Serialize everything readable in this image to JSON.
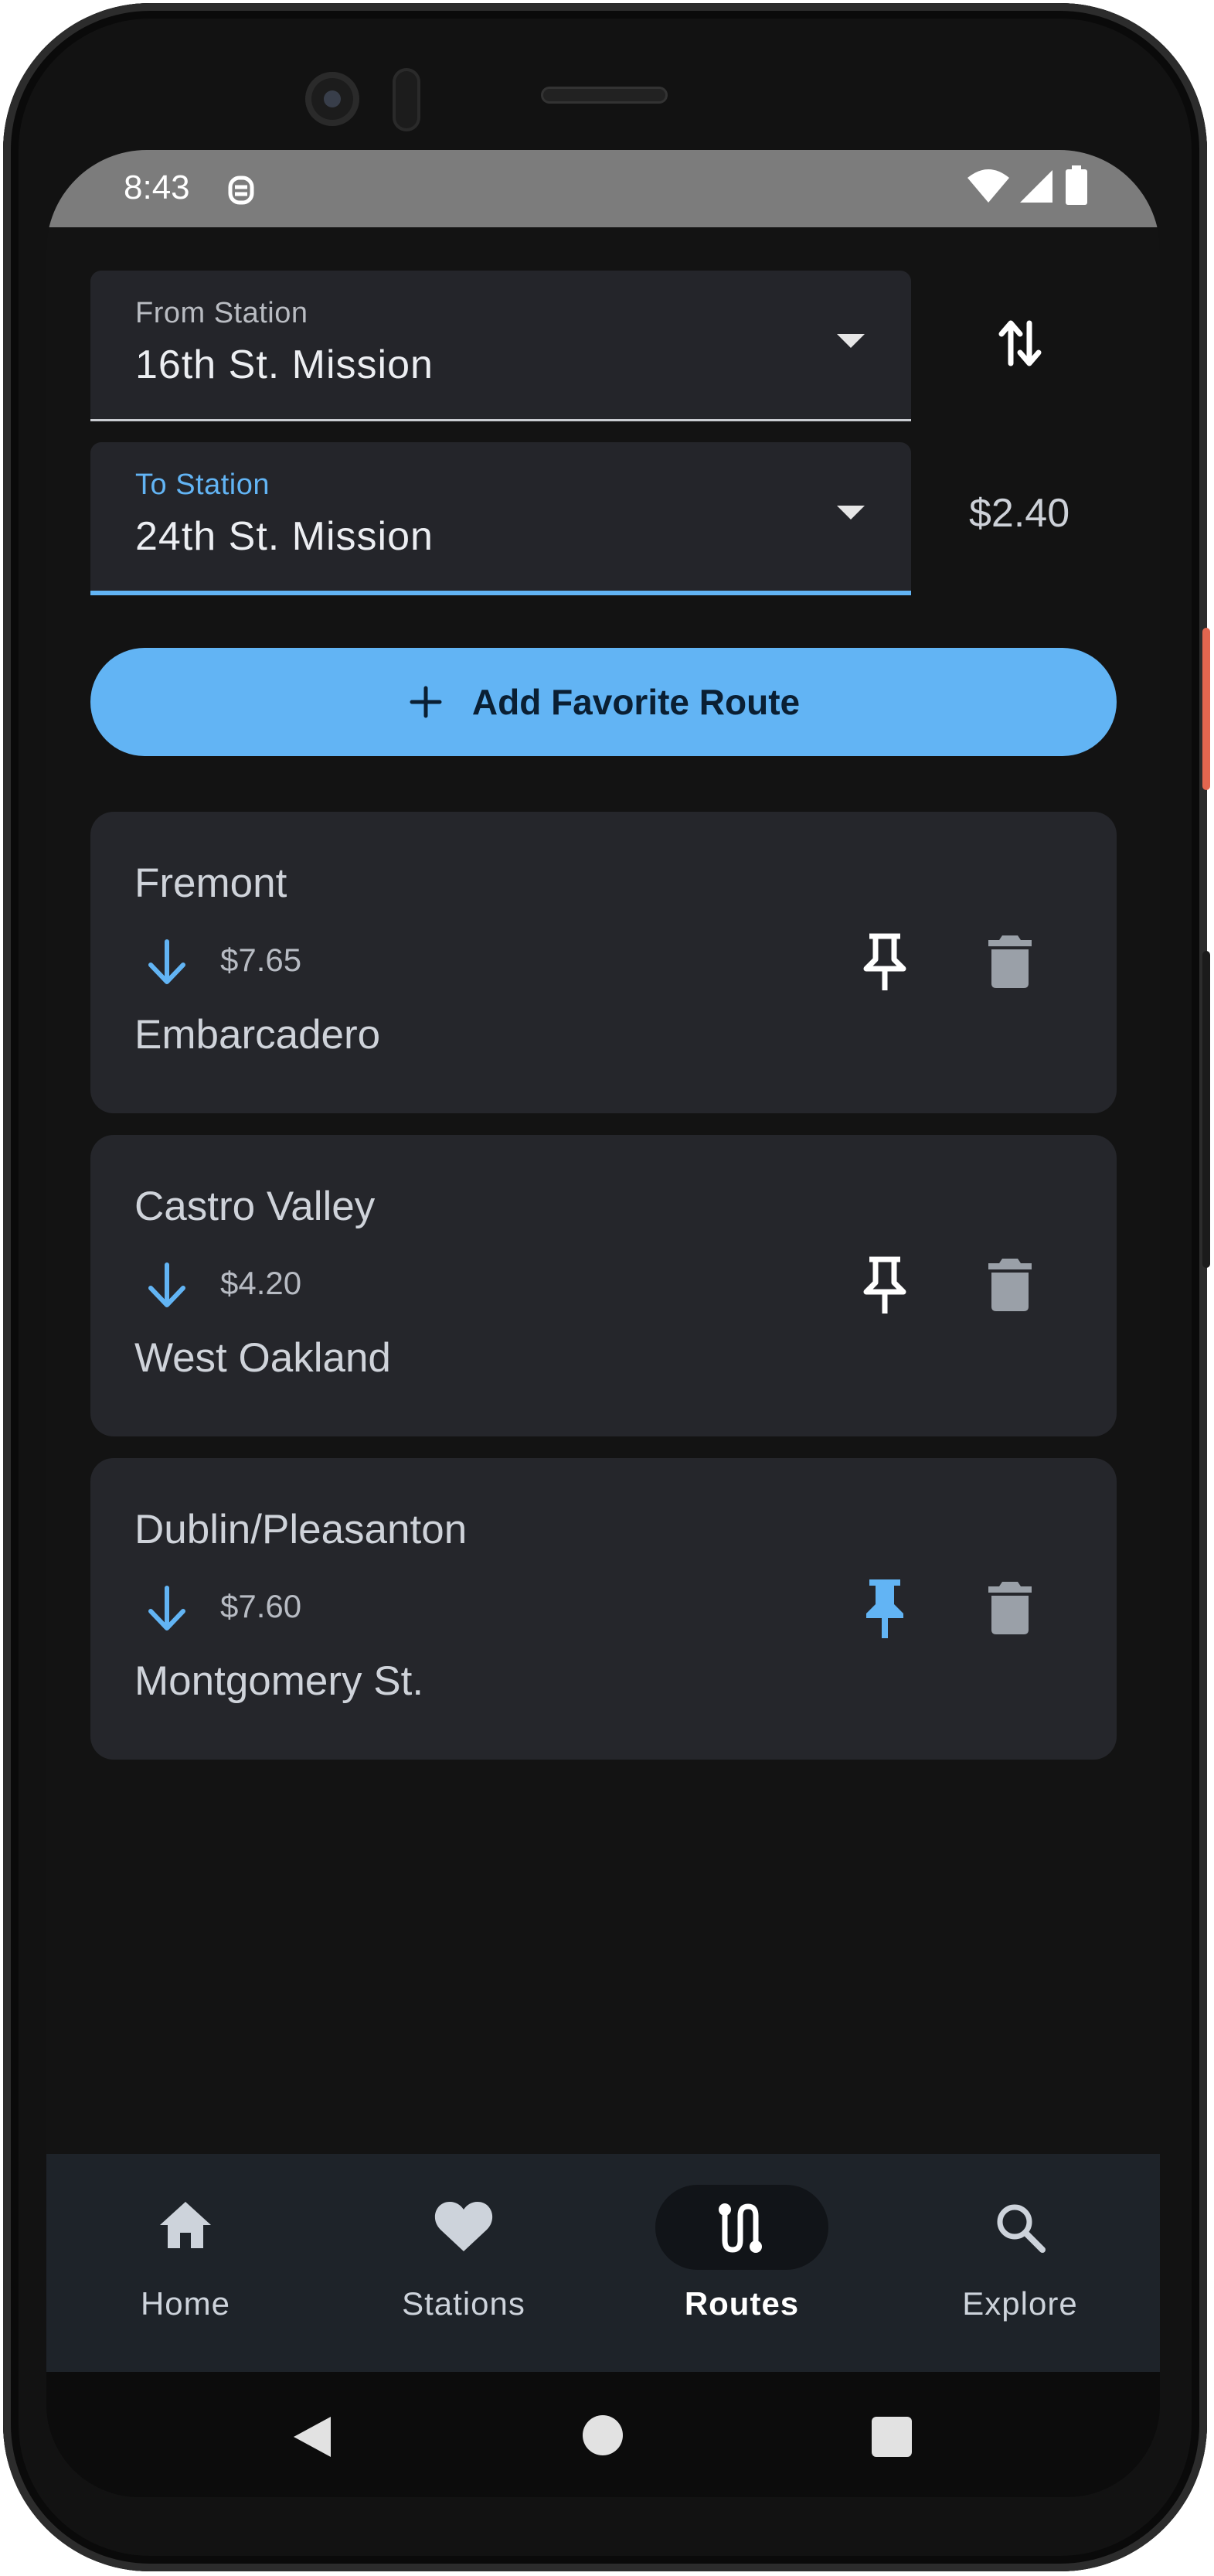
{
  "status_bar": {
    "time": "8:43"
  },
  "from_station": {
    "label": "From Station",
    "value": "16th St. Mission"
  },
  "to_station": {
    "label": "To Station",
    "value": "24th St. Mission"
  },
  "fare": "$2.40",
  "add_favorite_route": {
    "label": "Add Favorite Route",
    "icon": "plus-icon"
  },
  "routes": [
    {
      "from": "Fremont",
      "fare": "$7.65",
      "to": "Embarcadero",
      "pinned": false
    },
    {
      "from": "Castro Valley",
      "fare": "$4.20",
      "to": "West Oakland",
      "pinned": false
    },
    {
      "from": "Dublin/Pleasanton",
      "fare": "$7.60",
      "to": "Montgomery St.",
      "pinned": true
    }
  ],
  "bottom_nav": {
    "items": [
      {
        "label": "Home",
        "icon": "home-icon"
      },
      {
        "label": "Stations",
        "icon": "heart-icon"
      },
      {
        "label": "Routes",
        "icon": "routes-icon",
        "selected": true
      },
      {
        "label": "Explore",
        "icon": "search-icon"
      }
    ]
  },
  "colors": {
    "accent": "#62b4f4",
    "background": "#131313",
    "card": "#25262b",
    "nav_background": "#1e2329"
  }
}
